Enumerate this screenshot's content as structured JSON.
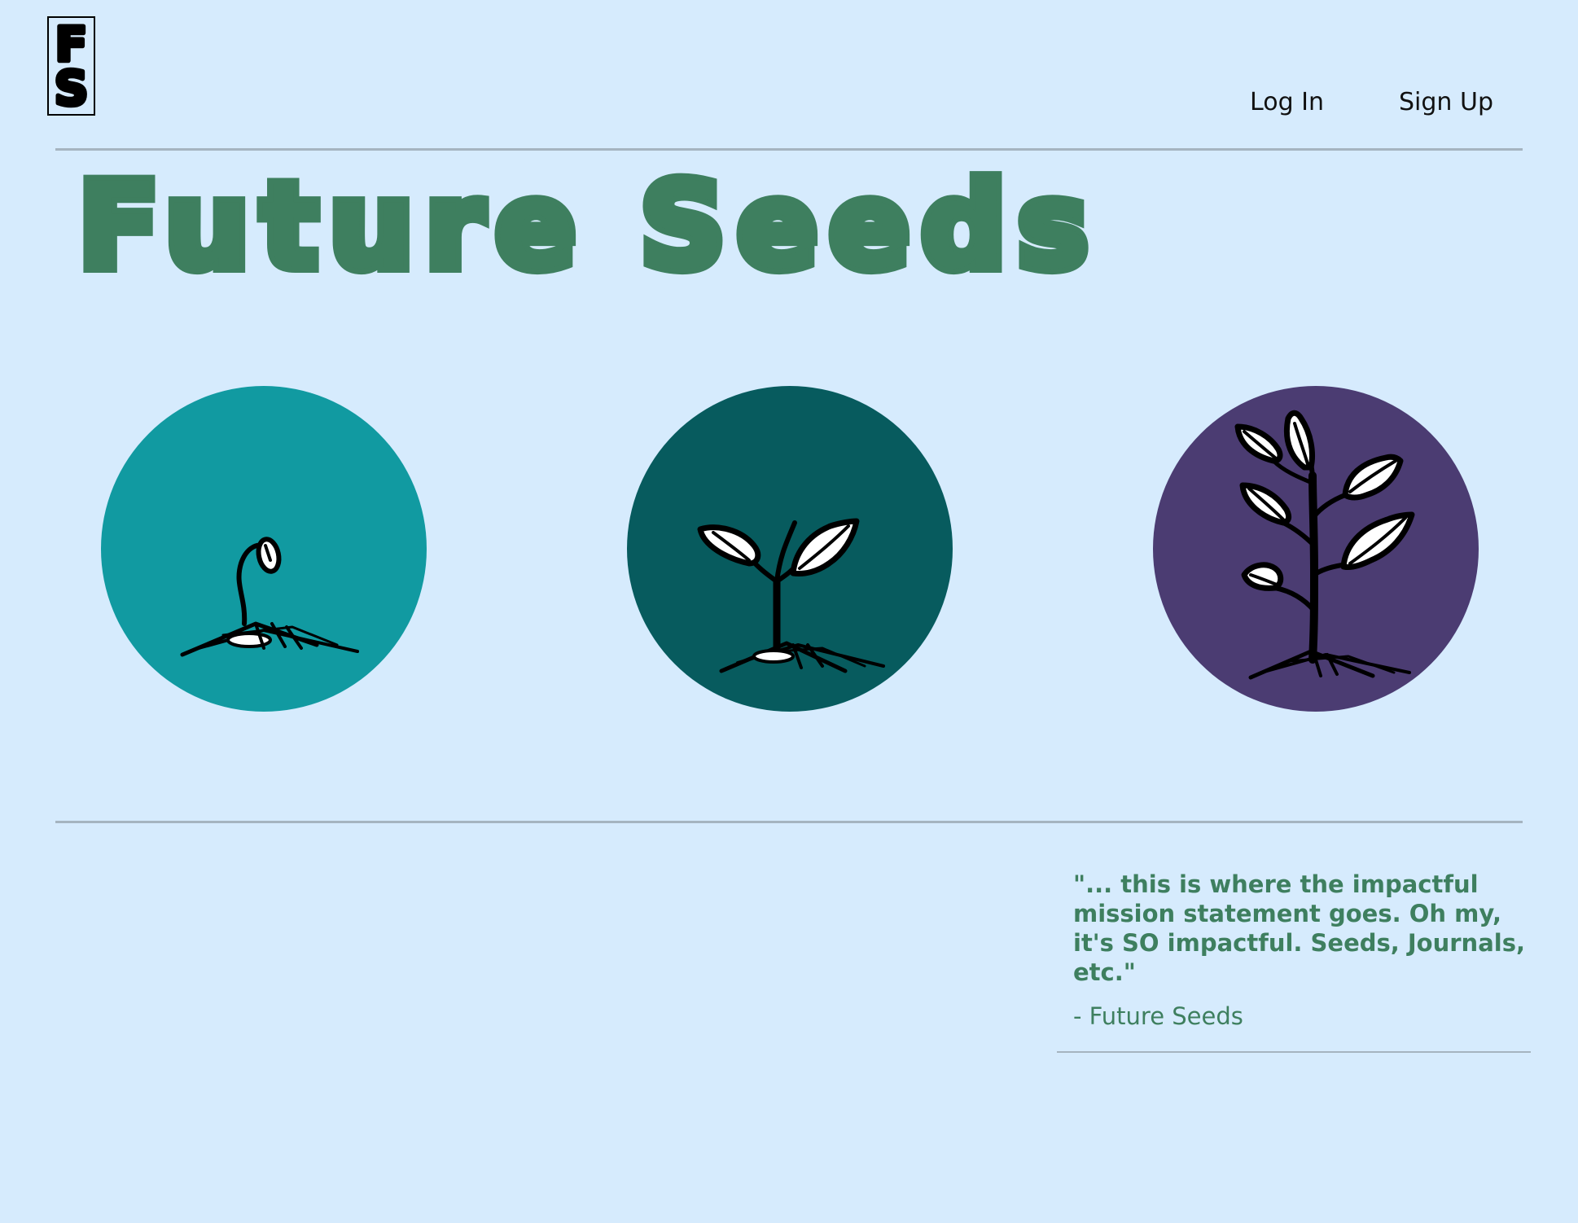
{
  "colors": {
    "background": "#d6ebfd",
    "accent_green": "#3e7f5f",
    "divider": "#a5b4c0",
    "circle_teal": "#119aa1",
    "circle_dark_teal": "#075b5e",
    "circle_purple": "#4b3c72"
  },
  "header": {
    "logo": {
      "text": "FS",
      "letters": [
        "F",
        "S"
      ]
    },
    "nav": [
      {
        "label": "Log In"
      },
      {
        "label": "Sign Up"
      }
    ]
  },
  "hero": {
    "title": "Future Seeds"
  },
  "stages": [
    {
      "icon": "sprouting-seed-icon",
      "color": "#119aa1"
    },
    {
      "icon": "seedling-icon",
      "color": "#075b5e"
    },
    {
      "icon": "young-plant-icon",
      "color": "#4b3c72"
    }
  ],
  "quote": {
    "text": "\"... this is where the impactful mission statement goes. Oh my, it's SO impactful. Seeds, Journals, etc.\"",
    "attribution": "- Future Seeds"
  }
}
